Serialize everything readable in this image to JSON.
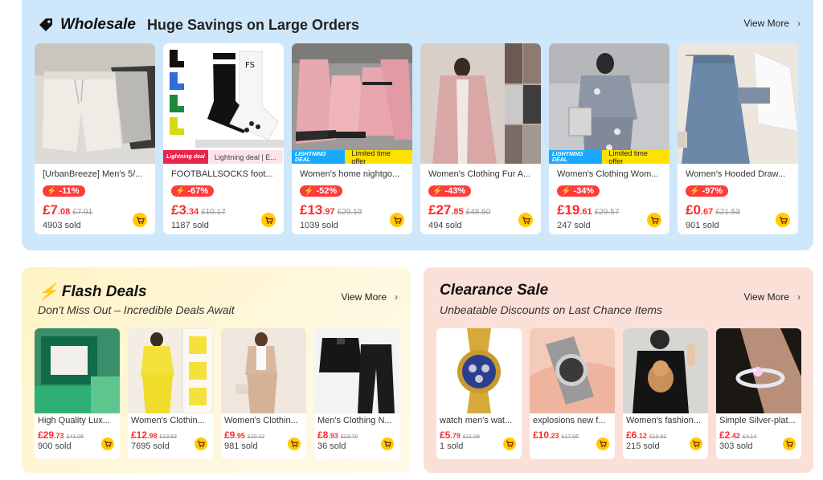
{
  "wholesale": {
    "title": "Wholesale",
    "subtitle": "Huge Savings on Large Orders",
    "view_more": "View More",
    "products": [
      {
        "title": "[UrbanBreeze] Men's 5/...",
        "discount": "-11%",
        "price_main": "£7",
        "price_dec": ".08",
        "old_price": "£7.91",
        "sold": "4903 sold",
        "image": "grey-shorts"
      },
      {
        "title": "FOOTBALLSOCKS foot...",
        "discount": "-67%",
        "price_main": "£3",
        "price_dec": ".34",
        "old_price": "£10.17",
        "sold": "1187 sold",
        "image": "football-socks",
        "deal": {
          "tag": "Lightning deal",
          "text": "Lightning deal | E..."
        }
      },
      {
        "title": "Women's home nightgo...",
        "discount": "-52%",
        "price_main": "£13",
        "price_dec": ".97",
        "old_price": "£29.19",
        "sold": "1039 sold",
        "image": "pink-nightgown",
        "deal": {
          "tag": "LIGHTNING DEAL",
          "text": "Limited time offer"
        }
      },
      {
        "title": "Women's Clothing Fur A...",
        "discount": "-43%",
        "price_main": "£27",
        "price_dec": ".85",
        "old_price": "£48.50",
        "sold": "494 sold",
        "image": "fur-coat"
      },
      {
        "title": "Women's Clothing Wom...",
        "discount": "-34%",
        "price_main": "£19",
        "price_dec": ".61",
        "old_price": "£29.57",
        "sold": "247 sold",
        "image": "grey-set",
        "deal": {
          "tag": "LIGHTNING DEAL",
          "text": "Limited time offer"
        }
      },
      {
        "title": "Women's Hooded Draw...",
        "discount": "-97%",
        "price_main": "£0",
        "price_dec": ".67",
        "old_price": "£21.53",
        "sold": "901 sold",
        "image": "denim-skirt"
      }
    ]
  },
  "flash": {
    "title": "Flash Deals",
    "subtitle": "Don't Miss Out – Incredible Deals Await",
    "view_more": "View More",
    "products": [
      {
        "title": "High Quality Lux...",
        "price_main": "£29",
        "price_dec": ".73",
        "old_price": "£41.08",
        "sold": "900 sold",
        "image": "green-watch-box"
      },
      {
        "title": "Women's Clothin...",
        "price_main": "£12",
        "price_dec": ".98",
        "old_price": "£13.83",
        "sold": "7695 sold",
        "image": "yellow-set"
      },
      {
        "title": "Women's Clothin...",
        "price_main": "£9",
        "price_dec": ".95",
        "old_price": "£20.12",
        "sold": "981 sold",
        "image": "beige-set"
      },
      {
        "title": "Men's Clothing N...",
        "price_main": "£8",
        "price_dec": ".93",
        "old_price": "£23.70",
        "sold": "36 sold",
        "image": "black-set"
      }
    ]
  },
  "clearance": {
    "title": "Clearance Sale",
    "subtitle": "Unbeatable Discounts on Last Chance Items",
    "view_more": "View More",
    "products": [
      {
        "title": "watch men's wat...",
        "price_main": "£5",
        "price_dec": ".79",
        "old_price": "£11.09",
        "sold": "1 sold",
        "image": "gold-watch"
      },
      {
        "title": "explosions new f...",
        "price_main": "£10",
        "price_dec": ".23",
        "old_price": "£17.06",
        "sold": "",
        "image": "silver-watch"
      },
      {
        "title": "Women's fashion...",
        "price_main": "£6",
        "price_dec": ".12",
        "old_price": "£10.91",
        "sold": "215 sold",
        "image": "bear-tshirt"
      },
      {
        "title": "Simple Silver-plat...",
        "price_main": "£2",
        "price_dec": ".42",
        "old_price": "£4.14",
        "sold": "303 sold",
        "image": "silver-ring"
      }
    ]
  },
  "colors": {
    "wholesale_bg": "#cfe7fb",
    "flash_bg": "#fff3c4",
    "clearance_bg": "#fbe0d8",
    "price": "#ff2a2a",
    "badge": "#ff3b3b",
    "cart": "#ffcc00"
  }
}
